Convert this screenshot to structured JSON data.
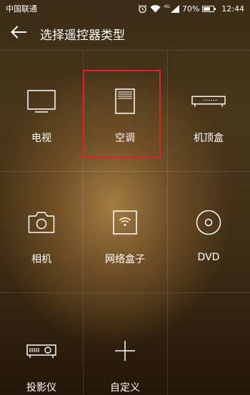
{
  "status_bar": {
    "carrier": "中国联通",
    "signal_tag": "4G",
    "battery": "70%",
    "battery_level": 0.7,
    "time": "12:44",
    "icons": [
      "alarm-icon",
      "wifi-icon",
      "cellular-signal-icon",
      "battery-icon"
    ]
  },
  "header": {
    "title": "选择遥控器类型",
    "back_icon": "arrow-left-icon"
  },
  "device_types": [
    {
      "label": "电视",
      "icon": "tv-icon"
    },
    {
      "label": "空调",
      "icon": "air-conditioner-icon"
    },
    {
      "label": "机顶盒",
      "icon": "set-top-box-icon"
    },
    {
      "label": "相机",
      "icon": "camera-icon"
    },
    {
      "label": "网络盒子",
      "icon": "network-box-icon"
    },
    {
      "label": "DVD",
      "icon": "dvd-disc-icon"
    },
    {
      "label": "投影仪",
      "icon": "projector-icon"
    },
    {
      "label": "自定义",
      "icon": "plus-icon"
    }
  ],
  "highlight": {
    "target": "空调",
    "color": "#e0202a"
  },
  "colors": {
    "text": "#ffffff",
    "accent_highlight": "#e0202a"
  }
}
